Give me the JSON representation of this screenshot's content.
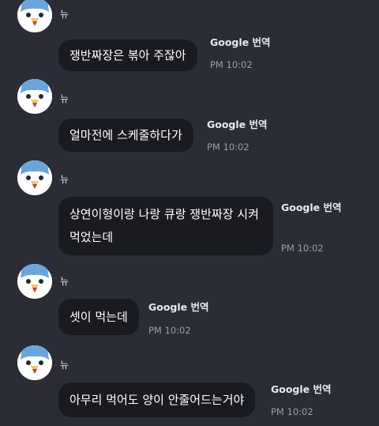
{
  "messages": [
    {
      "sender": "뉴",
      "text": "쟁반짜장은 볶아 주잖아",
      "translate": "Google 번역",
      "time": "PM 10:02"
    },
    {
      "sender": "뉴",
      "text": "얼마전에 스케줄하다가",
      "translate": "Google 번역",
      "time": "PM 10:02"
    },
    {
      "sender": "뉴",
      "text": "상연이형이랑 나랑 큐랑 쟁반짜장 시켜먹었는데",
      "translate": "Google 번역",
      "time": "PM 10:02"
    },
    {
      "sender": "뉴",
      "text": "셋이 먹는데",
      "translate": "Google 번역",
      "time": "PM 10:02"
    },
    {
      "sender": "뉴",
      "text": "아무리 먹어도 양이 안줄어드는거야",
      "translate": "Google 번역",
      "time": "PM 10:02"
    }
  ],
  "colors": {
    "background": "#2b2d36",
    "bubble": "#1a1b20",
    "avatar_blue": "#6aa6dc",
    "avatar_beak": "#f2c85a",
    "time": "#9a9ca6"
  },
  "icons": {
    "avatar": "penguin-avatar-icon"
  }
}
